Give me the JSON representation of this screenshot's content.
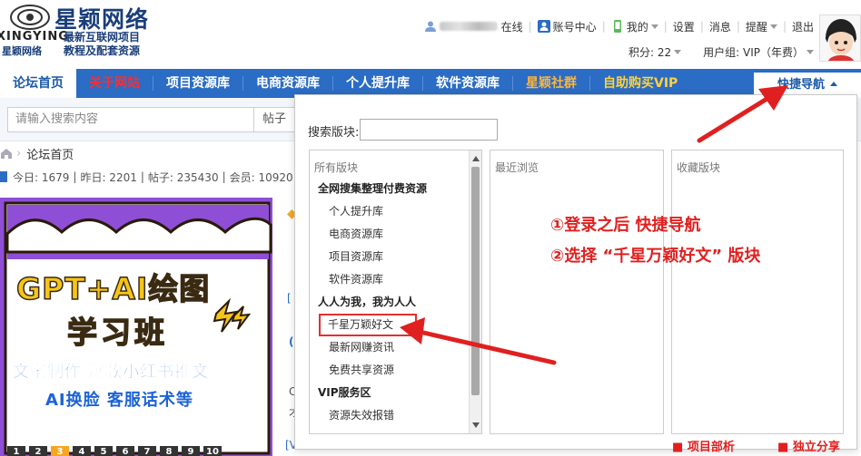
{
  "logo": {
    "brand": "星颖网络",
    "en": "XINGYING",
    "sub_cn": "星颖网络",
    "slogan_line1": "最新互联网项目",
    "slogan_line2": "教程及配套资源"
  },
  "userbar": {
    "online": "在线",
    "account_center": "账号中心",
    "mine": "我的",
    "settings": "设置",
    "messages": "消息",
    "reminders": "提醒",
    "logout": "退出",
    "points": "积分: 22",
    "user_group": "用户组: VIP（年费）"
  },
  "nav": {
    "items": [
      {
        "label": "论坛首页"
      },
      {
        "label": "关于网站"
      },
      {
        "label": "项目资源库"
      },
      {
        "label": "电商资源库"
      },
      {
        "label": "个人提升库"
      },
      {
        "label": "软件资源库"
      },
      {
        "label": "星颖社群"
      },
      {
        "label": "自助购买VIP"
      }
    ],
    "quick_nav": "快捷导航"
  },
  "search": {
    "placeholder": "请输入搜索内容",
    "type": "帖子"
  },
  "breadcrumb": {
    "home": "论坛首页"
  },
  "stats": {
    "today": "今日: 1679",
    "yesterday": "昨日: 2201",
    "posts": "帖子: 235430",
    "members": "会员: 10920"
  },
  "banner": {
    "title1": "GPT+AI绘图",
    "title2": "学习班",
    "line1": "文案制作 爆款小红书推文",
    "line2": "AI换脸 客服话术等",
    "pages": [
      "1",
      "2",
      "3",
      "4",
      "5",
      "6",
      "7",
      "8",
      "9",
      "10"
    ],
    "active_page": 2
  },
  "popup": {
    "search_label": "搜索版块:",
    "col_all": "所有版块",
    "col_recent": "最近浏览",
    "col_fav": "收藏版块",
    "forums": [
      {
        "type": "group",
        "label": "全网搜集整理付费资源"
      },
      {
        "type": "item",
        "label": "个人提升库"
      },
      {
        "type": "item",
        "label": "电商资源库"
      },
      {
        "type": "item",
        "label": "项目资源库"
      },
      {
        "type": "item",
        "label": "软件资源库"
      },
      {
        "type": "group",
        "label": "人人为我，我为人人"
      },
      {
        "type": "item",
        "label": "千星万颖好文",
        "highlight": true
      },
      {
        "type": "item",
        "label": "最新网赚资讯"
      },
      {
        "type": "item",
        "label": "免费共享资源"
      },
      {
        "type": "group",
        "label": "VIP服务区"
      },
      {
        "type": "item",
        "label": "资源失效报错"
      }
    ]
  },
  "annotations": {
    "step1": "①登录之后 快捷导航",
    "step2": "②选择 “千星万颖好文” 版块"
  },
  "bottom": {
    "right1": "项目部析",
    "right2": "独立分享"
  },
  "colors": {
    "nav_blue": "#2b6cc4",
    "annot_red": "#e02020"
  }
}
